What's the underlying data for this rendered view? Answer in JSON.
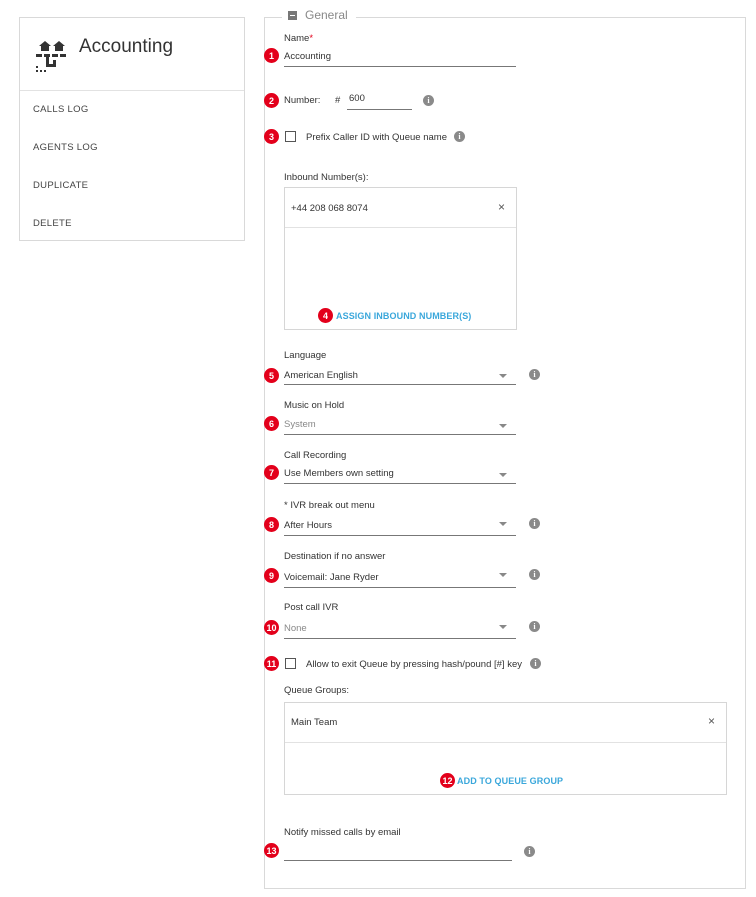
{
  "sidebar": {
    "title": "Accounting",
    "items": [
      {
        "label": "CALLS LOG"
      },
      {
        "label": "AGENTS LOG"
      },
      {
        "label": "DUPLICATE"
      },
      {
        "label": "DELETE"
      }
    ]
  },
  "general": {
    "legend": "General",
    "name_label": "Name",
    "required_marker": "*",
    "name_value": "Accounting",
    "number_label": "Number:",
    "number_prefix": "#",
    "number_value": "600",
    "prefix_label": "Prefix Caller ID with Queue name",
    "inbound_label": "Inbound Number(s):",
    "inbound_numbers": [
      "+44 208 068 8074"
    ],
    "assign_link": "ASSIGN INBOUND NUMBER(S)",
    "language_label": "Language",
    "language_value": "American English",
    "moh_label": "Music on Hold",
    "moh_value": "System",
    "recording_label": "Call Recording",
    "recording_value": "Use Members own setting",
    "ivr_label": "* IVR break out menu",
    "ivr_value": "After Hours",
    "dest_label": "Destination if no answer",
    "dest_value": "Voicemail: Jane Ryder",
    "post_ivr_label": "Post call IVR",
    "post_ivr_value": "None",
    "exit_label": "Allow to exit Queue by pressing hash/pound [#] key",
    "groups_label": "Queue Groups:",
    "groups": [
      "Main Team"
    ],
    "add_group_link": "ADD TO QUEUE GROUP",
    "notify_label": "Notify missed calls by email",
    "notify_value": ""
  },
  "badges": [
    "1",
    "2",
    "3",
    "4",
    "5",
    "6",
    "7",
    "8",
    "9",
    "10",
    "11",
    "12",
    "13"
  ],
  "icons": {
    "info": "i",
    "close": "×"
  },
  "colors": {
    "badge": "#e3001b",
    "link": "#3aa7db"
  }
}
